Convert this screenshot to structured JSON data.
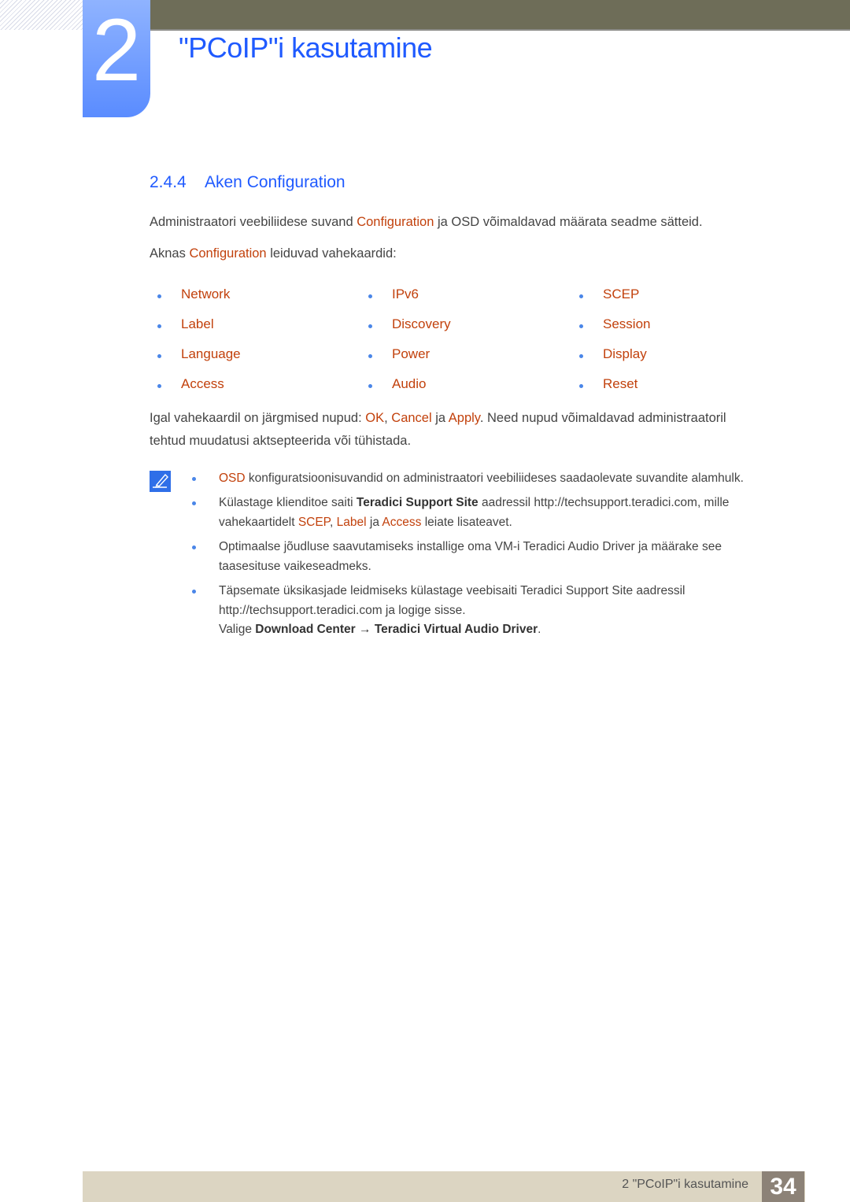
{
  "header": {
    "chapter_number": "2",
    "chapter_title": "\"PCoIP\"i kasutamine"
  },
  "section": {
    "number": "2.4.4",
    "title": "Aken Configuration"
  },
  "intro": {
    "p1_a": "Administraatori veebiliidese suvand ",
    "p1_hl": "Configuration",
    "p1_b": " ja OSD võimaldavad määrata seadme sätteid.",
    "p2_a": "Aknas ",
    "p2_hl": "Configuration",
    "p2_b": " leiduvad vahekaardid:"
  },
  "tabs": {
    "col1": [
      "Network",
      "Label",
      "Language",
      "Access"
    ],
    "col2": [
      "IPv6",
      "Discovery",
      "Power",
      "Audio"
    ],
    "col3": [
      "SCEP",
      "Session",
      "Display",
      "Reset"
    ]
  },
  "buttons_para": {
    "a": "Igal vahekaardil on järgmised nupud: ",
    "ok": "OK",
    "sep": ", ",
    "cancel": "Cancel",
    "ja": " ja ",
    "apply": "Apply",
    "b": ". Need nupud võimaldavad administraatoril",
    "line2": "tehtud muudatusi aktsepteerida või tühistada."
  },
  "notes": {
    "n1_hl": "OSD",
    "n1_text": " konfiguratsioonisuvandid on administraatori veebiliideses saadaolevate suvandite alamhulk.",
    "n2_a": "Külastage klienditoe saiti ",
    "n2_bold": "Teradici Support Site",
    "n2_b": " aadressil http://techsupport.teradici.com, mille",
    "n2_c": "vahekaartidelt ",
    "n2_scep": "SCEP",
    "n2_sep": ", ",
    "n2_label": "Label",
    "n2_ja": " ja ",
    "n2_access": "Access",
    "n2_d": " leiate lisateavet.",
    "n3_line1": "Optimaalse jõudluse saavutamiseks installige oma VM-i Teradici Audio Driver ja määrake see",
    "n3_line2": "taasesituse vaikeseadmeks.",
    "n4_line1": "Täpsemate üksikasjade leidmiseks külastage veebisaiti Teradici Support Site aadressil",
    "n4_line2": "http://techsupport.teradici.com ja logige sisse.",
    "n4_valige": "Valige ",
    "n4_dc": "Download Center",
    "n4_arrow": " → ",
    "n4_tvad": "Teradici Virtual Audio Driver",
    "n4_end": "."
  },
  "footer": {
    "chapter_label": "2 \"PCoIP\"i kasutamine",
    "page_number": "34"
  },
  "colors": {
    "heading_blue": "#1f5aff",
    "highlight_orange": "#c2410c",
    "bullet_blue": "#4a86e8",
    "top_bar": "#6e6d58",
    "footer_bg": "#dcd5c2",
    "page_box": "#8c8277"
  }
}
